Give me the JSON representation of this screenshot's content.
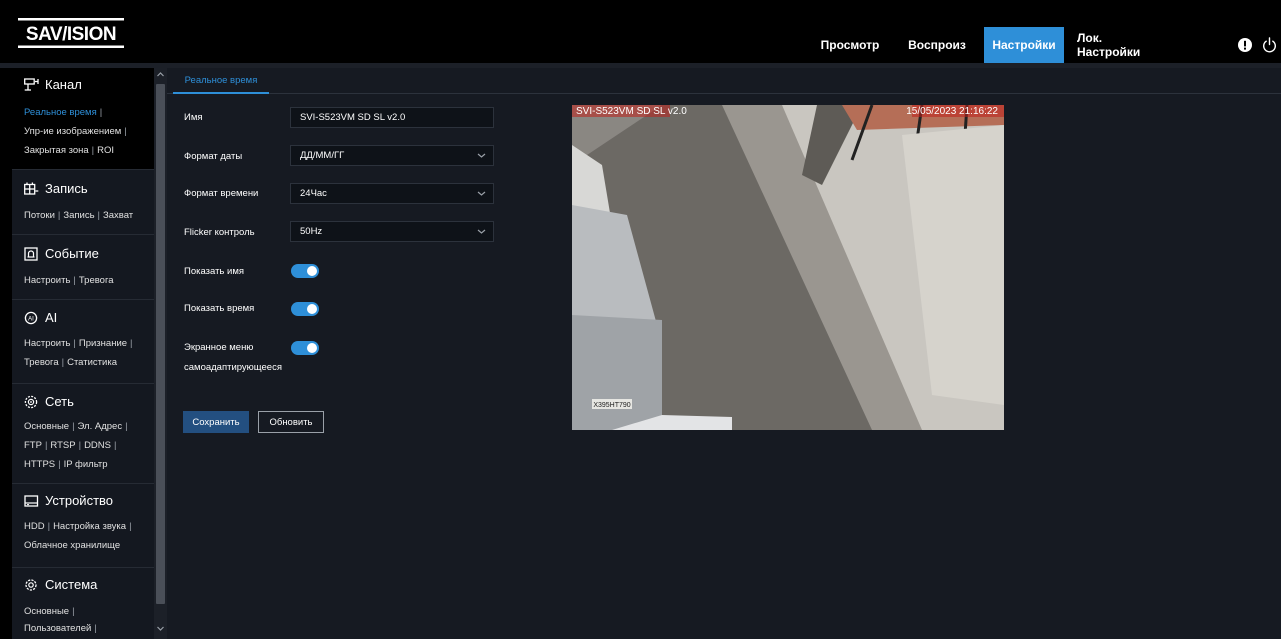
{
  "header": {
    "logo_text": "SAV/ISION",
    "nav": [
      {
        "label": "Просмотр",
        "active": false
      },
      {
        "label": "Воспроиз",
        "active": false
      },
      {
        "label": "Настройки",
        "active": true
      },
      {
        "label": "Лок. Настройки",
        "active": false
      }
    ],
    "icons": [
      "alert-icon",
      "power-icon"
    ],
    "accent_color": "#2e8fd8"
  },
  "sidebar": {
    "sections": [
      {
        "title": "Канал",
        "icon": "camera-icon",
        "active": true,
        "lines": [
          [
            "Реальное время"
          ],
          [
            "Упр-ие изображением"
          ],
          [
            "Закрытая зона",
            "ROI"
          ]
        ]
      },
      {
        "title": "Запись",
        "icon": "record-icon",
        "lines": [
          [
            "Потоки",
            "Запись",
            "Захват"
          ]
        ]
      },
      {
        "title": "Событие",
        "icon": "event-icon",
        "lines": [
          [
            "Настроить",
            "Тревога"
          ]
        ]
      },
      {
        "title": "AI",
        "icon": "ai-icon",
        "lines": [
          [
            "Настроить",
            "Признание"
          ],
          [
            "Тревога",
            "Статистика"
          ]
        ]
      },
      {
        "title": "Сеть",
        "icon": "network-icon",
        "lines": [
          [
            "Основные",
            "Эл. Адрес"
          ],
          [
            "FTP",
            "RTSP",
            "DDNS"
          ],
          [
            "HTTPS",
            "IP фильтр"
          ]
        ]
      },
      {
        "title": "Устройство",
        "icon": "device-icon",
        "lines": [
          [
            "HDD",
            "Настройка звука"
          ],
          [
            "Облачное хранилище"
          ]
        ]
      },
      {
        "title": "Система",
        "icon": "system-gear-icon",
        "lines": [
          [
            "Основные"
          ],
          [
            "Пользователей"
          ]
        ]
      }
    ],
    "current_item": "Реальное время"
  },
  "main": {
    "tabs": [
      {
        "label": "Реальное время",
        "active": true
      }
    ],
    "form": {
      "name_label": "Имя",
      "name_value": "SVI-S523VM SD SL v2.0",
      "date_format_label": "Формат даты",
      "date_format_value": "ДД/ММ/ГГ",
      "time_format_label": "Формат времени",
      "time_format_value": "24Час",
      "flicker_label": "Flicker контроль",
      "flicker_value": "50Hz",
      "show_name_label": "Показать имя",
      "show_name_on": true,
      "show_time_label": "Показать время",
      "show_time_on": true,
      "osd_adaptive_label_line1": "Экранное меню",
      "osd_adaptive_label_line2": "самоадаптирующееся",
      "osd_adaptive_on": true
    },
    "buttons": {
      "save": "Сохранить",
      "refresh": "Обновить"
    },
    "preview": {
      "osd_name": "SVI-S523VM SD SL v2.0",
      "osd_time": "15/05/2023 21:16:22",
      "plate_text": "Х395НТ790"
    }
  }
}
